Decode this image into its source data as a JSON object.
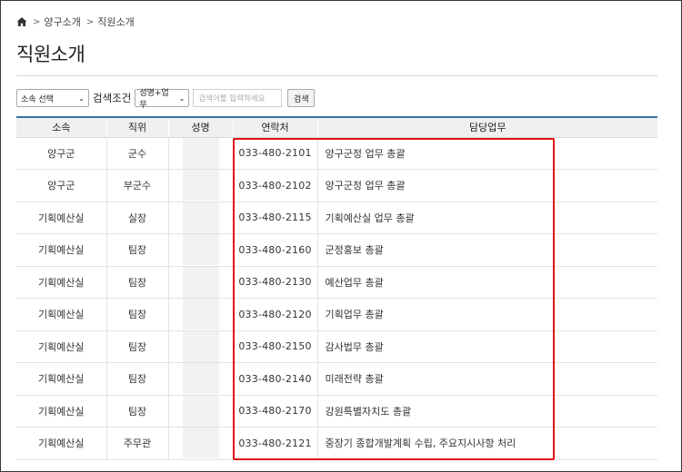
{
  "breadcrumb": {
    "items": [
      "양구소개",
      "직원소개"
    ]
  },
  "page": {
    "title": "직원소개"
  },
  "search": {
    "department_select": "소속 선택",
    "condition_label": "검색조건",
    "condition_select": "성명+업무",
    "keyword_placeholder": "검색어를 입력하세요",
    "button": "검색"
  },
  "table": {
    "headers": [
      "소속",
      "직위",
      "성명",
      "연락처",
      "담당업무"
    ],
    "rows": [
      {
        "dept": "양구군",
        "position": "군수",
        "name": "",
        "phone": "033-480-2101",
        "duty": "양구군정 업무 총괄"
      },
      {
        "dept": "양구군",
        "position": "부군수",
        "name": "",
        "phone": "033-480-2102",
        "duty": "양구군정 업무 총괄"
      },
      {
        "dept": "기획예산실",
        "position": "실장",
        "name": "",
        "phone": "033-480-2115",
        "duty": "기획예산실 업무 총괄"
      },
      {
        "dept": "기획예산실",
        "position": "팀장",
        "name": "",
        "phone": "033-480-2160",
        "duty": "군정홍보 총괄"
      },
      {
        "dept": "기획예산실",
        "position": "팀장",
        "name": "",
        "phone": "033-480-2130",
        "duty": "예산업무 총괄"
      },
      {
        "dept": "기획예산실",
        "position": "팀장",
        "name": "",
        "phone": "033-480-2120",
        "duty": "기획업무 총괄"
      },
      {
        "dept": "기획예산실",
        "position": "팀장",
        "name": "",
        "phone": "033-480-2150",
        "duty": "감사법무 총괄"
      },
      {
        "dept": "기획예산실",
        "position": "팀장",
        "name": "",
        "phone": "033-480-2140",
        "duty": "미래전략 총괄"
      },
      {
        "dept": "기획예산실",
        "position": "팀장",
        "name": "",
        "phone": "033-480-2170",
        "duty": "강원특별자치도 총괄"
      },
      {
        "dept": "기획예산실",
        "position": "주무관",
        "name": "",
        "phone": "033-480-2121",
        "duty": "중장기 종합개발계획 수립, 주요지시사항 처리"
      }
    ]
  },
  "colors": {
    "header_rule": "#3b6fa4",
    "highlight": "#e11616"
  },
  "icons": {
    "home": "home-icon",
    "chevron": "chevron-down-icon",
    "separator": "chevron-right-icon"
  }
}
